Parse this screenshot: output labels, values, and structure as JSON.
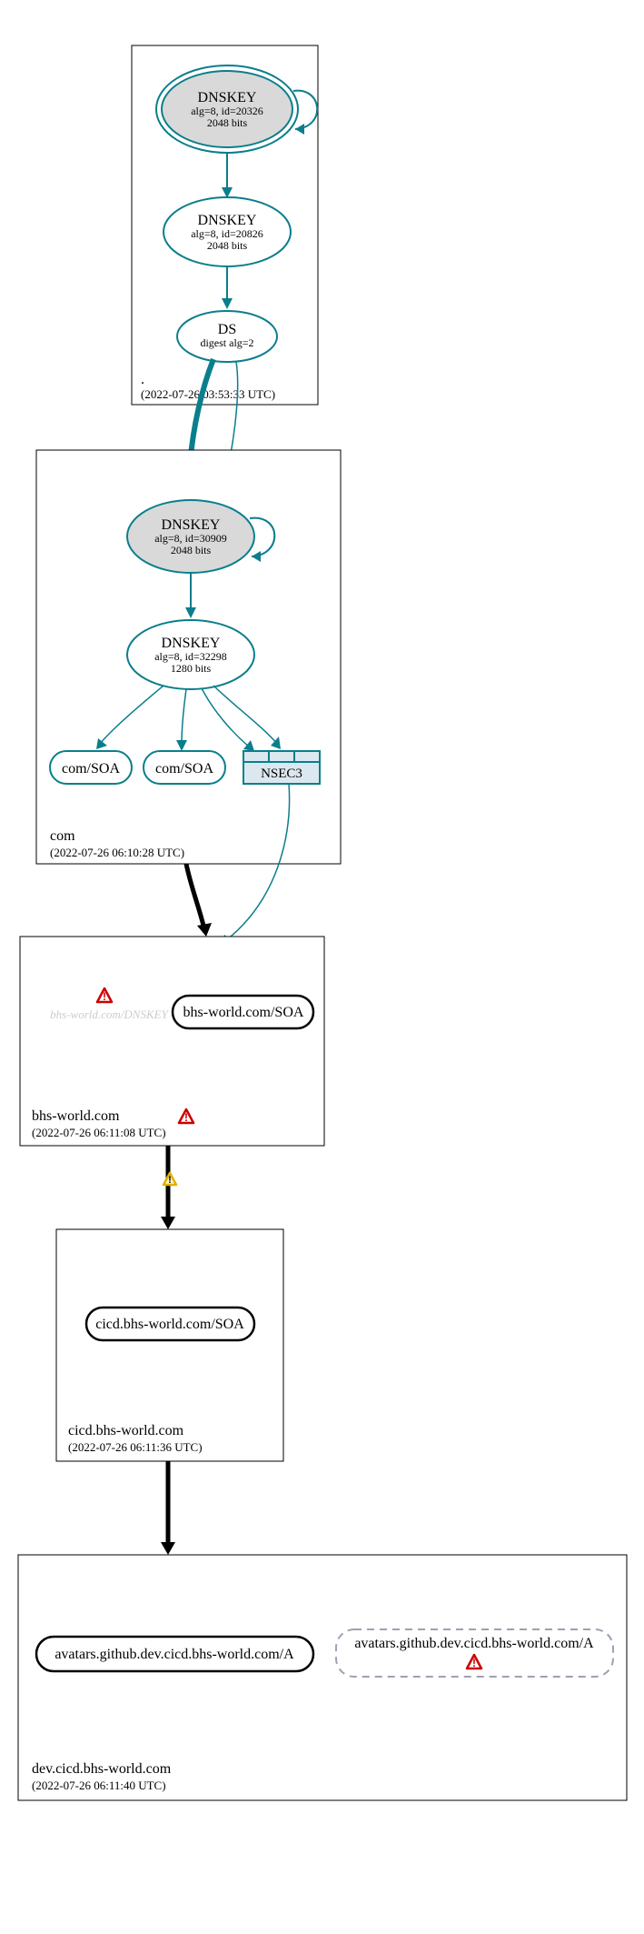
{
  "zones": {
    "root": {
      "label": ".",
      "timestamp": "(2022-07-26 03:53:33 UTC)",
      "dnskey_ksk": {
        "title": "DNSKEY",
        "line2": "alg=8, id=20326",
        "line3": "2048 bits"
      },
      "dnskey_zsk": {
        "title": "DNSKEY",
        "line2": "alg=8, id=20826",
        "line3": "2048 bits"
      },
      "ds": {
        "title": "DS",
        "line2": "digest alg=2"
      }
    },
    "com": {
      "label": "com",
      "timestamp": "(2022-07-26 06:10:28 UTC)",
      "dnskey_ksk": {
        "title": "DNSKEY",
        "line2": "alg=8, id=30909",
        "line3": "2048 bits"
      },
      "dnskey_zsk": {
        "title": "DNSKEY",
        "line2": "alg=8, id=32298",
        "line3": "1280 bits"
      },
      "soa1": "com/SOA",
      "soa2": "com/SOA",
      "nsec3": "NSEC3"
    },
    "bhsworld": {
      "label": "bhs-world.com",
      "timestamp": "(2022-07-26 06:11:08 UTC)",
      "dnskey_missing": "bhs-world.com/DNSKEY",
      "soa": "bhs-world.com/SOA"
    },
    "cicd": {
      "label": "cicd.bhs-world.com",
      "timestamp": "(2022-07-26 06:11:36 UTC)",
      "soa": "cicd.bhs-world.com/SOA"
    },
    "dev": {
      "label": "dev.cicd.bhs-world.com",
      "timestamp": "(2022-07-26 06:11:40 UTC)",
      "a_ok": "avatars.github.dev.cicd.bhs-world.com/A",
      "a_bad": "avatars.github.dev.cicd.bhs-world.com/A"
    }
  }
}
